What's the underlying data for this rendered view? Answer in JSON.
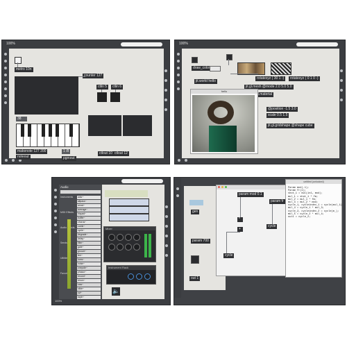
{
  "panels": {
    "top_left": {
      "zoom": "100%",
      "objects": {
        "metro": "metro 10n",
        "counter": "counter 127",
        "ctlin1": "ctlin 5",
        "ctlin2": "ctlin 6",
        "makenote": "makenote 127 200",
        "noteout": "noteout",
        "pgmout": "pgmout",
        "ctlout1": "ctlout 10",
        "ctlout2": "ctlout 12",
        "num": "38",
        "num2": "1 /8"
      }
    },
    "top_right": {
      "zoom": "100%",
      "objects": {
        "draw_color": "draw_color",
        "world": "jit.world hello",
        "rotatexyz1": "rotatexyz ( 30 1 -)",
        "rotatexyz2": "rotatexyz ( 0 1 0 -)",
        "mesh": "jit.gl.mesh @mode 2.0 5.0 5.0",
        "gridshape": "jit.gl.gridshape @shape cube",
        "material": "jit.gl.material",
        "position": "@position -1.5 3.0",
        "scale": "scale 0.5 1.5",
        "preview_title": "hello"
      }
    },
    "bottom_left": {
      "zoom": "100%",
      "browser_title": "Audio",
      "browser_search": "search",
      "categories": [
        "Instruments",
        "MIDI Effects",
        "Audio Effects",
        "Sends",
        "Utilities",
        "Favorites"
      ],
      "items": [
        "adsr~",
        "allpass~",
        "amxd~",
        "average~",
        "biquad~",
        "buffer~",
        "chorus~",
        "comb~",
        "cycle~",
        "degrade~",
        "delay~",
        "filter~",
        "gate~",
        "groove~",
        "limi~",
        "lores~",
        "noise~",
        "onepole~",
        "phasor~",
        "record~",
        "reson~",
        "saw~",
        "slide~",
        "svf~",
        "tapin~"
      ],
      "mixer_title": "Mixer",
      "instrument_title": "Instrument Rack",
      "track_labels": [
        "Audio",
        "2 Audio"
      ]
    },
    "bottom_right": {
      "zoom": "100%",
      "window_title": "untitled (unlocked)",
      "objects": {
        "param_mod": "param mod 0.1",
        "param_fr": "param fr",
        "gen": "gen",
        "cycle1": "cycle",
        "cycle2": "cycle",
        "param_vol": "param 700",
        "mul": "*",
        "add": "+",
        "out": "out 1"
      },
      "code_lines": [
        "Param mod(.1);",
        "Param fr(1);",
        "shot_1 = mul(in1, mod);",
        "mul_1 = shot_1 * fm;",
        "mul_2 = mul_1 * fm;",
        "mul_3 = mul_2 * mod;",
        "cycle_1, cycleindex_1 = cycle(mul_1);",
        "mul_4 = cycle_1 * mul_3;",
        "cycle_2, cycleindex_2 = cycle(m_);",
        "mul_5 = cycle_2 * mul_4;",
        "out1 = cycle_2;"
      ]
    }
  }
}
